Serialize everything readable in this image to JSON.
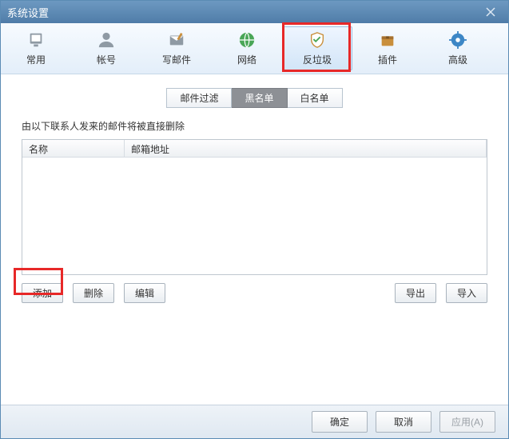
{
  "window": {
    "title": "系统设置"
  },
  "toolbar": {
    "items": [
      {
        "label": "常用"
      },
      {
        "label": "帐号"
      },
      {
        "label": "写邮件"
      },
      {
        "label": "网络"
      },
      {
        "label": "反垃圾"
      },
      {
        "label": "插件"
      },
      {
        "label": "高级"
      }
    ],
    "selected": 4
  },
  "tabs": {
    "items": [
      {
        "label": "邮件过滤"
      },
      {
        "label": "黑名单"
      },
      {
        "label": "白名单"
      }
    ],
    "active": 1
  },
  "section": {
    "description": "由以下联系人发来的邮件将被直接删除"
  },
  "list": {
    "columns": {
      "name": "名称",
      "email": "邮箱地址"
    },
    "rows": []
  },
  "buttons": {
    "add": "添加",
    "delete": "删除",
    "edit": "编辑",
    "export": "导出",
    "import": "导入"
  },
  "footer": {
    "ok": "确定",
    "cancel": "取消",
    "apply": "应用(A)"
  }
}
